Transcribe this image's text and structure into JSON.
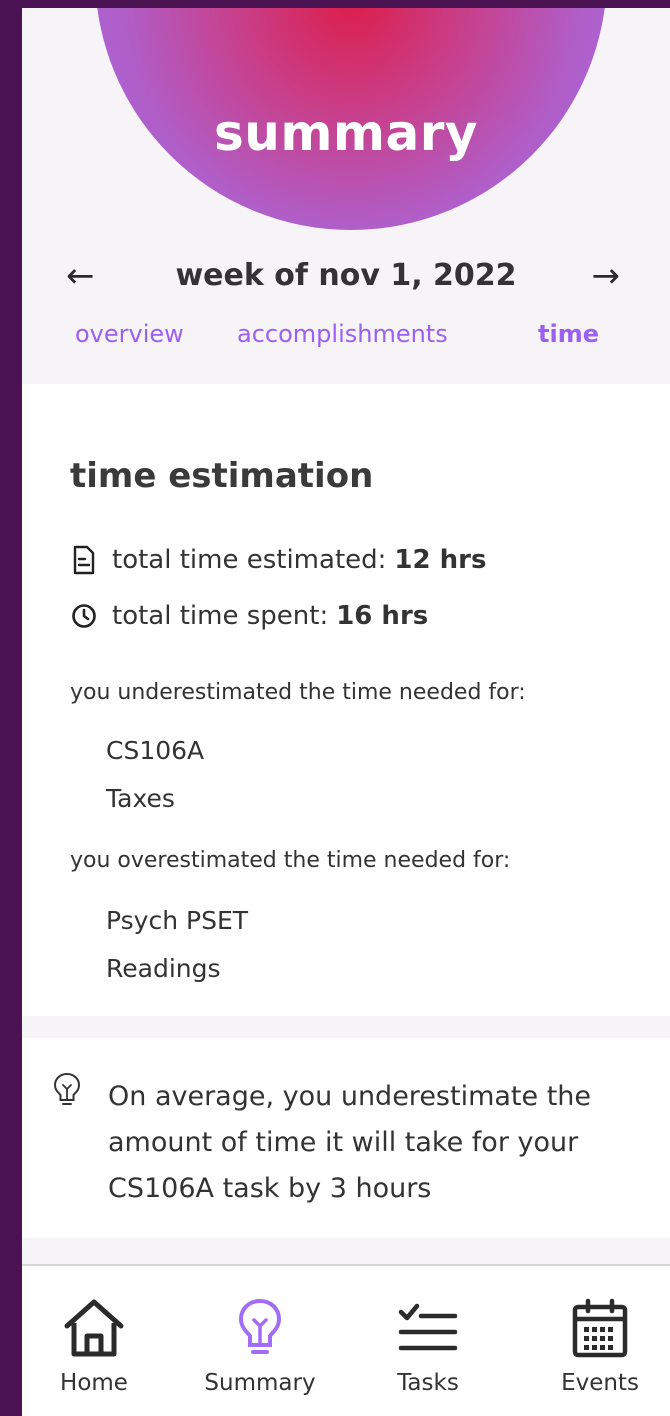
{
  "header": {
    "title": "summary"
  },
  "week": {
    "label": "week of nov 1, 2022",
    "prev_symbol": "←",
    "next_symbol": "→"
  },
  "tabs": [
    {
      "label": "overview"
    },
    {
      "label": "accomplishments"
    },
    {
      "label": "time"
    }
  ],
  "estimation": {
    "title": "time estimation",
    "estimated_label": "total time estimated:",
    "estimated_value": "12 hrs",
    "spent_label": "total time spent:",
    "spent_value": "16 hrs",
    "under_label": "you underestimated the time needed for:",
    "under_items": [
      "CS106A",
      "Taxes"
    ],
    "over_label": "you overestimated the time needed for:",
    "over_items": [
      "Psych PSET",
      "Readings"
    ]
  },
  "tip": {
    "text": "On average, you underestimate the amount of time it will take for your CS106A task by 3 hours"
  },
  "nav": [
    {
      "label": "Home",
      "icon": "home-icon"
    },
    {
      "label": "Summary",
      "icon": "lightbulb-icon"
    },
    {
      "label": "Tasks",
      "icon": "checklist-icon"
    },
    {
      "label": "Events",
      "icon": "calendar-icon"
    }
  ],
  "colors": {
    "accent": "#9b5ff2",
    "background": "#4a1250",
    "hero_center": "#dc1e4a"
  }
}
